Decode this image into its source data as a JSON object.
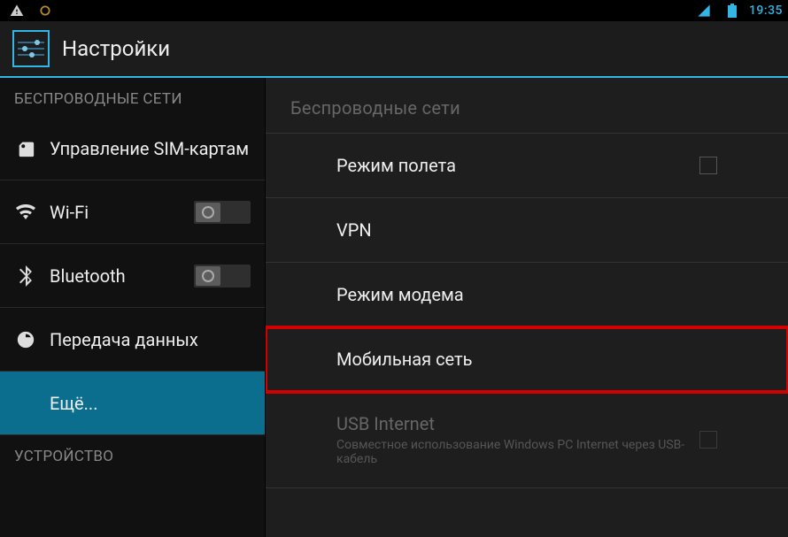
{
  "status": {
    "time": "19:35"
  },
  "header": {
    "title": "Настройки"
  },
  "sidebar": {
    "section_wireless": "БЕСПРОВОДНЫЕ СЕТИ",
    "items": [
      {
        "label": "Управление SIM-картам"
      },
      {
        "label": "Wi-Fi"
      },
      {
        "label": "Bluetooth"
      },
      {
        "label": "Передача данных"
      },
      {
        "label": "Ещё..."
      }
    ],
    "section_device": "УСТРОЙСТВО"
  },
  "main": {
    "section": "Беспроводные сети",
    "items": [
      {
        "label": "Режим полета"
      },
      {
        "label": "VPN"
      },
      {
        "label": "Режим модема"
      },
      {
        "label": "Мобильная сеть"
      },
      {
        "label": "USB Internet",
        "sub": "Совместное использование Windows PC Internet через USB-кабель"
      }
    ]
  }
}
